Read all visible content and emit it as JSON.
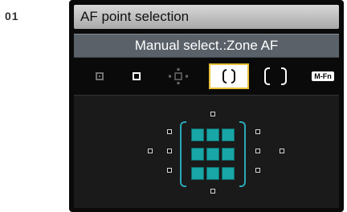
{
  "figure_number": "01",
  "menu": {
    "title": "AF point selection",
    "current_mode": "Manual select.:Zone AF"
  },
  "mode_icons": [
    {
      "name": "spot-af-icon",
      "active": false
    },
    {
      "name": "single-point-af-icon",
      "active": false
    },
    {
      "name": "af-point-expansion-icon",
      "active": false
    },
    {
      "name": "zone-af-icon",
      "active": true
    },
    {
      "name": "auto-selection-af-icon",
      "active": false
    },
    {
      "name": "m-fn-icon",
      "label": "M-Fn"
    }
  ],
  "colors": {
    "active_zone": "#19a6a6",
    "zone_bracket": "#2aa8b8",
    "title_bar": "#c8c8c8",
    "mode_bar": "#5a6169"
  }
}
